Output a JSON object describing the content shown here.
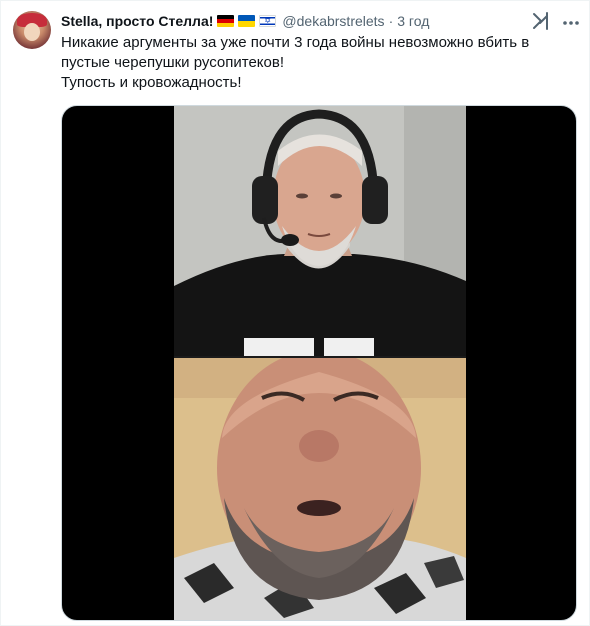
{
  "tweet": {
    "display_name": "Stella, просто Стелла!",
    "flags": [
      "flag-de",
      "flag-ua",
      "flag-il"
    ],
    "handle": "@dekabrstrelets",
    "separator": "·",
    "time": "3 год",
    "text_lines": [
      "Никакие аргументы за уже почти 3 года войны невозможно вбить в",
      "пустые черепушки русопитеков!",
      "Тупость и кровожадность!"
    ]
  },
  "icons": {
    "grok": "grok-icon",
    "more": "more-icon"
  },
  "colors": {
    "text_primary": "#0f1419",
    "text_secondary": "#536471",
    "media_background": "#000000"
  }
}
